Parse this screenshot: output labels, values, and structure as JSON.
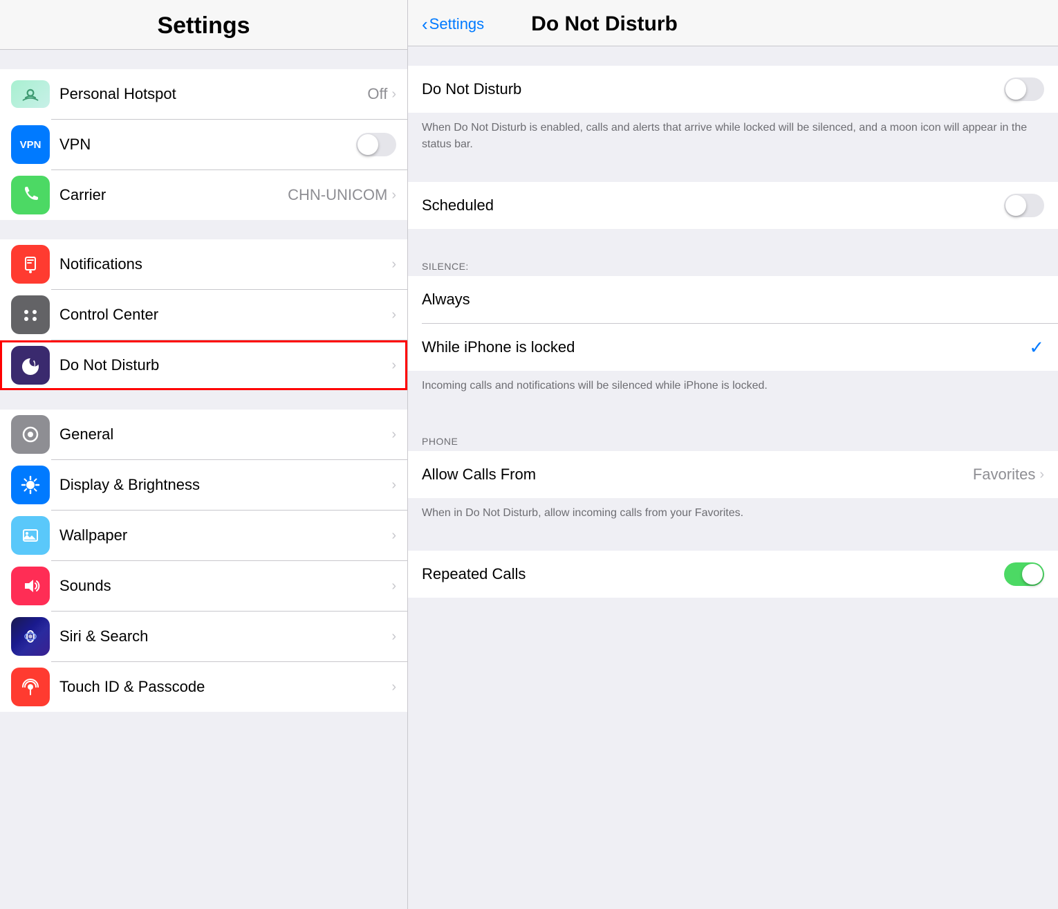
{
  "left": {
    "title": "Settings",
    "sections": [
      {
        "id": "network",
        "rows": [
          {
            "id": "personal-hotspot",
            "icon_color": "gradient-green",
            "label": "Personal Hotspot",
            "value": "Off",
            "has_chevron": true,
            "has_toggle": false,
            "highlighted": false
          },
          {
            "id": "vpn",
            "icon_color": "blue",
            "label": "VPN",
            "value": null,
            "has_chevron": false,
            "has_toggle": true,
            "toggle_on": false,
            "highlighted": false
          },
          {
            "id": "carrier",
            "icon_color": "green",
            "label": "Carrier",
            "value": "CHN-UNICOM",
            "has_chevron": true,
            "has_toggle": false,
            "highlighted": false
          }
        ]
      },
      {
        "id": "system",
        "rows": [
          {
            "id": "notifications",
            "icon_color": "red",
            "label": "Notifications",
            "value": null,
            "has_chevron": true,
            "highlighted": false
          },
          {
            "id": "control-center",
            "icon_color": "gray",
            "label": "Control Center",
            "value": null,
            "has_chevron": true,
            "highlighted": false
          },
          {
            "id": "do-not-disturb",
            "icon_color": "dark-purple",
            "label": "Do Not Disturb",
            "value": null,
            "has_chevron": true,
            "highlighted": true
          }
        ]
      },
      {
        "id": "device",
        "rows": [
          {
            "id": "general",
            "icon_color": "gray",
            "label": "General",
            "value": null,
            "has_chevron": true,
            "highlighted": false
          },
          {
            "id": "display-brightness",
            "icon_color": "blue",
            "label": "Display & Brightness",
            "value": null,
            "has_chevron": true,
            "highlighted": false
          },
          {
            "id": "wallpaper",
            "icon_color": "teal",
            "label": "Wallpaper",
            "value": null,
            "has_chevron": true,
            "highlighted": false
          },
          {
            "id": "sounds",
            "icon_color": "pink",
            "label": "Sounds",
            "value": null,
            "has_chevron": true,
            "highlighted": false
          },
          {
            "id": "siri-search",
            "icon_color": "dark-blue-gradient",
            "label": "Siri & Search",
            "value": null,
            "has_chevron": true,
            "highlighted": false
          },
          {
            "id": "touch-id",
            "icon_color": "red",
            "label": "Touch ID & Passcode",
            "value": null,
            "has_chevron": true,
            "highlighted": false
          }
        ]
      }
    ]
  },
  "right": {
    "back_label": "Settings",
    "title": "Do Not Disturb",
    "dnd_toggle": false,
    "dnd_description": "When Do Not Disturb is enabled, calls and alerts that arrive while locked will be silenced, and a moon icon will appear in the status bar.",
    "scheduled_toggle": false,
    "silence_header": "SILENCE:",
    "silence_always_label": "Always",
    "silence_while_locked_label": "While iPhone is locked",
    "silence_while_locked_checked": true,
    "silence_description": "Incoming calls and notifications will be silenced while iPhone is locked.",
    "phone_header": "PHONE",
    "allow_calls_from_label": "Allow Calls From",
    "allow_calls_from_value": "Favorites",
    "allow_calls_description": "When in Do Not Disturb, allow incoming calls from your Favorites.",
    "repeated_calls_label": "Repeated Calls",
    "repeated_calls_toggle": true
  }
}
